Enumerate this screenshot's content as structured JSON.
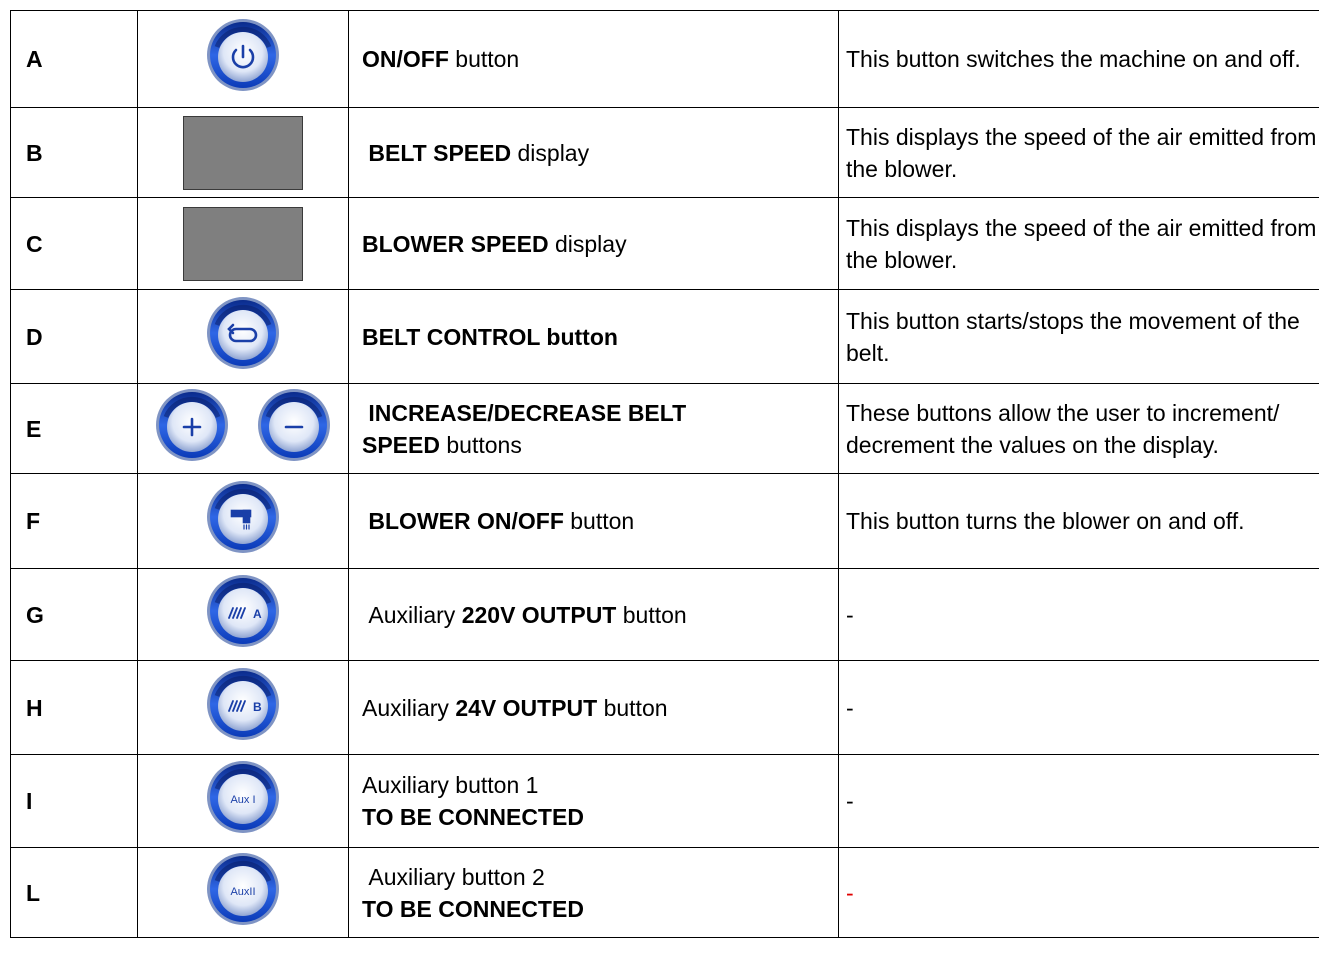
{
  "rows": [
    {
      "letter": "A",
      "icon": "power-icon",
      "icon_kind": "button",
      "name_parts": [
        {
          "text": "ON/OFF",
          "bold": true
        },
        {
          "text": " button",
          "bold": false
        }
      ],
      "desc": "This button switches the machine on and off.",
      "desc_red": false
    },
    {
      "letter": "B",
      "icon": "display-panel",
      "icon_kind": "display",
      "name_parts": [
        {
          "text": " BELT SPEED",
          "bold": true
        },
        {
          "text": " display",
          "bold": false
        }
      ],
      "desc": "This displays the speed of the air emitted from the blower.",
      "desc_red": false
    },
    {
      "letter": "C",
      "icon": "display-panel",
      "icon_kind": "display",
      "name_parts": [
        {
          "text": "BLOWER SPEED",
          "bold": true
        },
        {
          "text": " display",
          "bold": false
        }
      ],
      "desc": "This displays the speed of the air emitted from the blower.",
      "desc_red": false
    },
    {
      "letter": "D",
      "icon": "belt-loop-icon",
      "icon_kind": "button",
      "name_parts": [
        {
          "text": "BELT CONTROL button",
          "bold": true
        }
      ],
      "desc": "This button starts/stops the movement of the belt.",
      "desc_red": false
    },
    {
      "letter": "E",
      "icon": "plus-minus-icons",
      "icon_kind": "pair",
      "name_parts": [
        {
          "text": " INCREASE/DECREASE BELT",
          "bold": true,
          "break_after": true
        },
        {
          "text": "SPEED",
          "bold": true
        },
        {
          "text": " buttons",
          "bold": false
        }
      ],
      "desc": "These buttons allow the user to increment/ decrement the values on the display.",
      "desc_red": false
    },
    {
      "letter": "F",
      "icon": "blower-icon",
      "icon_kind": "button",
      "name_parts": [
        {
          "text": " BLOWER ON/OFF",
          "bold": true
        },
        {
          "text": " button",
          "bold": false
        }
      ],
      "desc": "This button turns the blower on and off.",
      "desc_red": false
    },
    {
      "letter": "G",
      "icon": "heater-a-icon",
      "icon_kind": "button",
      "icon_text": "A",
      "name_parts": [
        {
          "text": " Auxiliary ",
          "bold": false
        },
        {
          "text": "220V OUTPUT",
          "bold": true
        },
        {
          "text": " button",
          "bold": false
        }
      ],
      "desc": "-",
      "desc_red": false
    },
    {
      "letter": "H",
      "icon": "heater-b-icon",
      "icon_kind": "button",
      "icon_text": "B",
      "name_parts": [
        {
          "text": "Auxiliary ",
          "bold": false
        },
        {
          "text": "24V OUTPUT",
          "bold": true
        },
        {
          "text": " button",
          "bold": false
        }
      ],
      "desc": "-",
      "desc_red": false
    },
    {
      "letter": "I",
      "icon": "aux-1-icon",
      "icon_kind": "button",
      "icon_text": "Aux I",
      "name_parts": [
        {
          "text": "Auxiliary button 1",
          "bold": false,
          "break_after": true
        },
        {
          "text": "TO BE CONNECTED",
          "bold": true
        }
      ],
      "desc": "-",
      "desc_red": false
    },
    {
      "letter": "L",
      "icon": "aux-2-icon",
      "icon_kind": "button",
      "icon_text": "AuxII",
      "name_parts": [
        {
          "text": " Auxiliary button 2",
          "bold": false,
          "break_after": true
        },
        {
          "text": "TO BE CONNECTED",
          "bold": true
        }
      ],
      "desc": "-",
      "desc_red": true
    }
  ],
  "colors": {
    "button_blue": "#1a4fd0",
    "button_ring": "#c9d6ef",
    "display_gray": "#7f7f7f",
    "red_dash": "#e00000"
  }
}
